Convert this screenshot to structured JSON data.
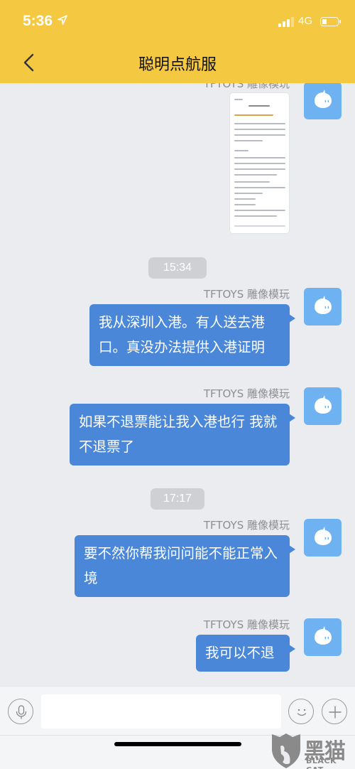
{
  "status_bar": {
    "time": "5:36",
    "network": "4G",
    "battery_level": 0.2
  },
  "header": {
    "title": "聪明点航服",
    "back_icon": "chevron-left-icon"
  },
  "chat": {
    "messages": [
      {
        "type": "image",
        "sender": "TFTOYS 雕像模玩",
        "content": "screenshot of an article (text illegible)"
      },
      {
        "type": "timestamp",
        "text": "15:34"
      },
      {
        "type": "text",
        "sender": "TFTOYS 雕像模玩",
        "text": "我从深圳入港。有人送去港口。真没办法提供入港证明"
      },
      {
        "type": "text",
        "sender": "TFTOYS 雕像模玩",
        "text": "如果不退票能让我入港也行 我就不退票了"
      },
      {
        "type": "timestamp",
        "text": "17:17"
      },
      {
        "type": "text",
        "sender": "TFTOYS 雕像模玩",
        "text": "要不然你帮我问问能不能正常入境"
      },
      {
        "type": "text",
        "sender": "TFTOYS 雕像模玩",
        "text": "我可以不退"
      }
    ],
    "partial_sender_top": "TFTOYS 雕像模玩"
  },
  "input_bar": {
    "voice_icon": "microphone-icon",
    "placeholder": "",
    "value": "",
    "emoji_icon": "smiley-icon",
    "more_icon": "plus-icon"
  },
  "watermark": {
    "cn": "黑猫",
    "en": "BLACK CAT"
  },
  "colors": {
    "header_bg": "#f5c842",
    "bubble_bg": "#4a87d8",
    "avatar_bg": "#6eb2f2",
    "chat_bg": "#ebecf0"
  }
}
